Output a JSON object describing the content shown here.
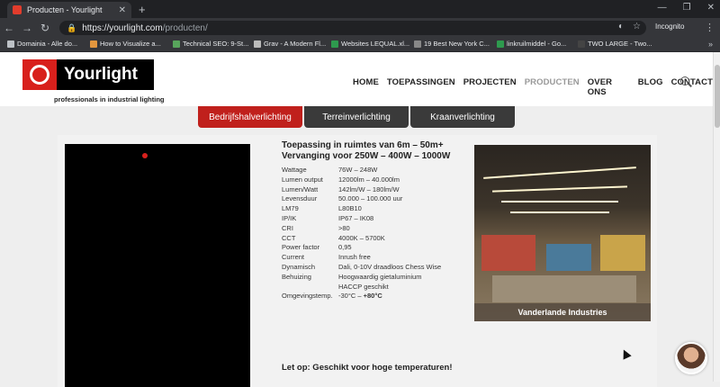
{
  "browser": {
    "tab_title": "Producten - Yourlight",
    "url_host": "https://yourlight.com",
    "url_path": "/producten/",
    "incognito_label": "Incognito",
    "bookmarks": [
      {
        "label": "Domainia - Alle do...",
        "color": "#6c8ebf"
      },
      {
        "label": "How to Visualize a...",
        "color": "#e3963e"
      },
      {
        "label": "Technical SEO: 9-St...",
        "color": "#58a55c"
      },
      {
        "label": "Grav - A Modern Fl...",
        "color": "#bbbbbb"
      },
      {
        "label": "Websites LEQUAL.xl...",
        "color": "#2e9a4e"
      },
      {
        "label": "19 Best New York C...",
        "color": "#888888"
      },
      {
        "label": "linkruilmiddel - Go...",
        "color": "#2e9a4e"
      },
      {
        "label": "TWO LARGE - Two...",
        "color": "#444444"
      }
    ]
  },
  "site": {
    "logo_text": "Yourlight",
    "tagline": "professionals in industrial lighting",
    "nav": [
      "HOME",
      "TOEPASSINGEN",
      "PROJECTEN",
      "PRODUCTEN",
      "OVER ONS",
      "BLOG",
      "CONTACT"
    ],
    "nav_active": "PRODUCTEN"
  },
  "category_tabs": [
    "Bedrijfshalverlichting",
    "Terreinverlichting",
    "Kraanverlichting"
  ],
  "product": {
    "title_line1": "Toepassing in ruimtes van 6m – 50m+",
    "title_line2": "Vervanging voor 250W – 400W – 1000W",
    "specs": [
      {
        "k": "Wattage",
        "v": "76W – 248W"
      },
      {
        "k": "Lumen output",
        "v": "12000lm – 40.000lm"
      },
      {
        "k": "Lumen/Watt",
        "v": "142lm/W – 180lm/W"
      },
      {
        "k": "Levensduur",
        "v": "50.000 – 100.000 uur"
      },
      {
        "k": "LM79",
        "v": "L80B10"
      },
      {
        "k": "IP/IK",
        "v": "IP67 – IK08"
      },
      {
        "k": "CRI",
        "v": ">80"
      },
      {
        "k": "CCT",
        "v": "4000K – 5700K"
      },
      {
        "k": "Power factor",
        "v": "0,95"
      },
      {
        "k": "Current",
        "v": "Inrush free"
      },
      {
        "k": "Dynamisch",
        "v": "Dali, 0-10V draadloos Chess Wise"
      },
      {
        "k": "Behuizing",
        "v": "Hoogwaardig gietaluminium"
      },
      {
        "k": "",
        "v": "HACCP geschikt"
      },
      {
        "k": "Omgevingstemp.",
        "v": "-30°C – ",
        "v_bold": "+80°C"
      }
    ],
    "note": "Let op: Geschikt voor hoge temperaturen!",
    "photo_caption": "Vanderlande Industries"
  }
}
